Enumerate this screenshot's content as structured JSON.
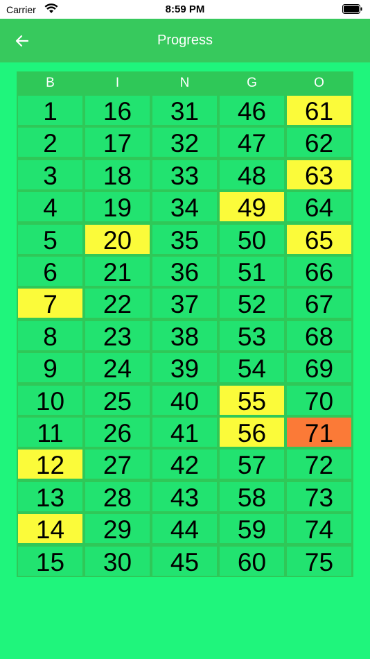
{
  "status_bar": {
    "carrier": "Carrier",
    "time": "8:59 PM"
  },
  "nav": {
    "title": "Progress",
    "back_icon": "arrow-left-icon"
  },
  "colors": {
    "called": "#fbfb3a",
    "latest": "#fb7a37",
    "normal": "#22e370"
  },
  "board": {
    "headers": [
      "B",
      "I",
      "N",
      "G",
      "O"
    ],
    "columns": [
      {
        "letter": "B",
        "numbers": [
          "1",
          "2",
          "3",
          "4",
          "5",
          "6",
          "7",
          "8",
          "9",
          "10",
          "11",
          "12",
          "13",
          "14",
          "15"
        ]
      },
      {
        "letter": "I",
        "numbers": [
          "16",
          "17",
          "18",
          "19",
          "20",
          "21",
          "22",
          "23",
          "24",
          "25",
          "26",
          "27",
          "28",
          "29",
          "30"
        ]
      },
      {
        "letter": "N",
        "numbers": [
          "31",
          "32",
          "33",
          "34",
          "35",
          "36",
          "37",
          "38",
          "39",
          "40",
          "41",
          "42",
          "43",
          "44",
          "45"
        ]
      },
      {
        "letter": "G",
        "numbers": [
          "46",
          "47",
          "48",
          "49",
          "50",
          "51",
          "52",
          "53",
          "54",
          "55",
          "56",
          "57",
          "58",
          "59",
          "60"
        ]
      },
      {
        "letter": "O",
        "numbers": [
          "61",
          "62",
          "63",
          "64",
          "65",
          "66",
          "67",
          "68",
          "69",
          "70",
          "71",
          "72",
          "73",
          "74",
          "75"
        ]
      }
    ],
    "called": [
      "7",
      "12",
      "14",
      "20",
      "49",
      "55",
      "56",
      "61",
      "63",
      "65"
    ],
    "latest": "71"
  }
}
